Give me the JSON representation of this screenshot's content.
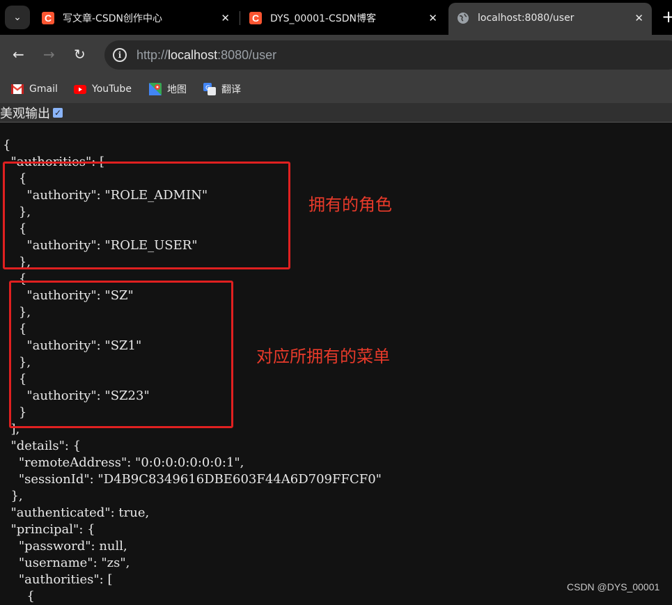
{
  "tabs": [
    {
      "title": "写文章-CSDN创作中心",
      "favicon": "csdn-icon"
    },
    {
      "title": "DYS_00001-CSDN博客",
      "favicon": "csdn-icon"
    },
    {
      "title": "localhost:8080/user",
      "favicon": "globe-icon",
      "active": true
    }
  ],
  "tab_favicon_letter": "C",
  "close_glyph": "✕",
  "new_tab_glyph": "+",
  "address": {
    "scheme": "http://",
    "host": "localhost",
    "rest": ":8080/user"
  },
  "bookmarks": [
    {
      "label": "Gmail",
      "icon": "gmail-icon"
    },
    {
      "label": "YouTube",
      "icon": "youtube-icon"
    },
    {
      "label": "地图",
      "icon": "maps-icon"
    },
    {
      "label": "翻译",
      "icon": "translate-icon"
    }
  ],
  "pretty_print": {
    "label": "美观输出",
    "checked": true
  },
  "json_lines": [
    "{",
    "  \"authorities\": [",
    "    {",
    "      \"authority\": \"ROLE_ADMIN\"",
    "    },",
    "    {",
    "      \"authority\": \"ROLE_USER\"",
    "    },",
    "    {",
    "      \"authority\": \"SZ\"",
    "    },",
    "    {",
    "      \"authority\": \"SZ1\"",
    "    },",
    "    {",
    "      \"authority\": \"SZ23\"",
    "    }",
    "  ],",
    "  \"details\": {",
    "    \"remoteAddress\": \"0:0:0:0:0:0:0:1\",",
    "    \"sessionId\": \"D4B9C8349616DBE603F44A6D709FFCF0\"",
    "  },",
    "  \"authenticated\": true,",
    "  \"principal\": {",
    "    \"password\": null,",
    "    \"username\": \"zs\",",
    "    \"authorities\": [",
    "      {"
  ],
  "annotations": {
    "roles": "拥有的角色",
    "menus": "对应所拥有的菜单"
  },
  "watermark": "CSDN @DYS_00001",
  "colors": {
    "annotation": "#e02020",
    "csdn": "#fc5531"
  }
}
